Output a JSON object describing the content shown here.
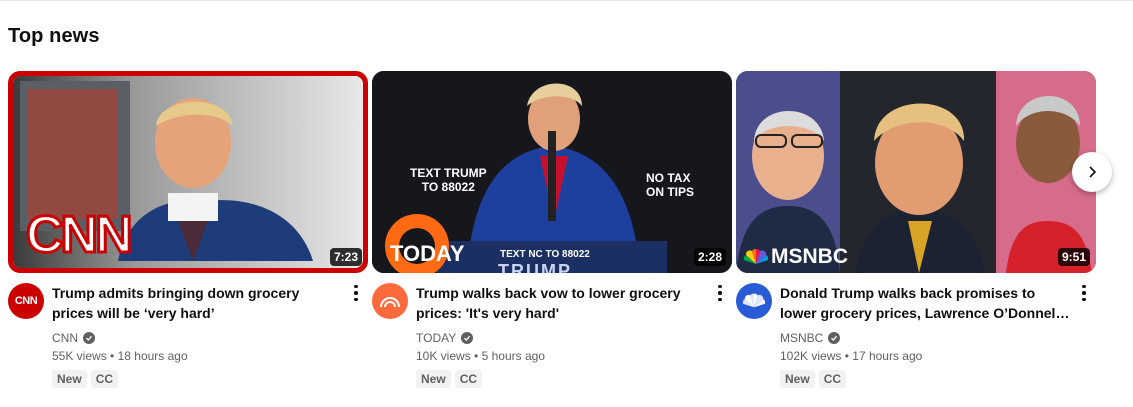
{
  "section": {
    "title": "Top news"
  },
  "videos": [
    {
      "duration": "7:23",
      "title": "Trump admits bringing down grocery prices will be ‘very hard’",
      "channel": "CNN",
      "views": "55K views",
      "age": "18 hours ago",
      "badges": [
        "New",
        "CC"
      ],
      "thumb_logo": "CNN",
      "accent": "#cc0000",
      "avatar_text": "CNN"
    },
    {
      "duration": "2:28",
      "title": "Trump walks back vow to lower grocery prices: 'It's very hard'",
      "channel": "TODAY",
      "views": "10K views",
      "age": "5 hours ago",
      "badges": [
        "New",
        "CC"
      ],
      "thumb_logo": "TODAY",
      "thumb_text_1": "TEXT TRUMP",
      "thumb_text_2": "TO 88022",
      "thumb_text_3": "NO TAX",
      "thumb_text_4": "ON TIPS",
      "podium_text": "TEXT NC TO 88022",
      "podium_big": "TRUMP",
      "accent": "#ff5a1f"
    },
    {
      "duration": "9:51",
      "title": "Donald Trump walks back promises to lower grocery prices, Lawrence O’Donnell weighs in",
      "channel": "MSNBC",
      "views": "102K views",
      "age": "17 hours ago",
      "badges": [
        "New",
        "CC"
      ],
      "thumb_logo": "MSNBC",
      "accent": "#2a5bd7"
    }
  ],
  "icons": {
    "verified": "verified-check-icon",
    "more": "more-vert-icon",
    "next": "chevron-right-icon"
  }
}
